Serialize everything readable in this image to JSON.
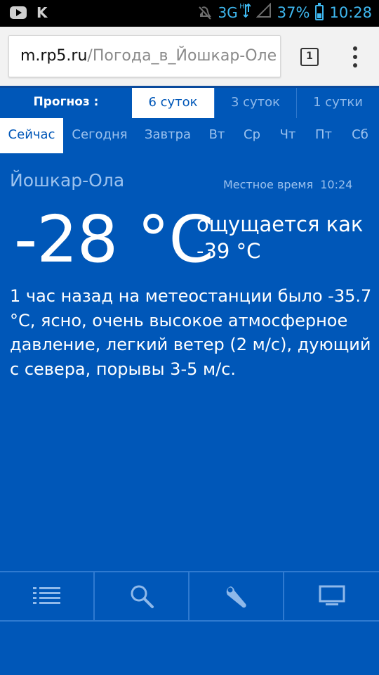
{
  "statusbar": {
    "network": "3G",
    "network_sub": "H",
    "battery": "37%",
    "time": "10:28",
    "icons": [
      "youtube-icon",
      "kaspersky-k-icon",
      "mute-icon",
      "signal-icon",
      "battery-icon"
    ]
  },
  "browser": {
    "url_host": "m.rp5.ru",
    "url_path": "/Погода_в_Йошкар-Оле",
    "tab_count": "1"
  },
  "forecast": {
    "label": "Прогноз :",
    "tabs": [
      {
        "label": "6 суток",
        "active": true
      },
      {
        "label": "3 суток",
        "active": false
      },
      {
        "label": "1 сутки",
        "active": false
      }
    ]
  },
  "days": [
    {
      "label": "Сейчас",
      "active": true
    },
    {
      "label": "Сегодня",
      "active": false
    },
    {
      "label": "Завтра",
      "active": false
    },
    {
      "label": "Вт",
      "active": false
    },
    {
      "label": "Ср",
      "active": false
    },
    {
      "label": "Чт",
      "active": false
    },
    {
      "label": "Пт",
      "active": false
    },
    {
      "label": "Сб",
      "active": false
    }
  ],
  "weather": {
    "city": "Йошкар-Ола",
    "local_time_label": "Местное время",
    "local_time": "10:24",
    "temperature": "-28 °C",
    "feels_label": "ощущается как",
    "feels_value": "-39 °C",
    "description": "1 час назад на метеостанции было -35.7 °C, ясно, очень высокое атмосферное давление, легкий ветер (2 м/с), дующий с севера, порывы 3-5 м/с."
  },
  "bottom_nav": [
    "list-icon",
    "search-icon",
    "wrench-icon",
    "monitor-icon"
  ],
  "colors": {
    "background": "#0057b8",
    "active_tab_bg": "#ffffff",
    "inactive_tab_text": "#9cc2ee",
    "status_icon": "#3fb8f0"
  }
}
